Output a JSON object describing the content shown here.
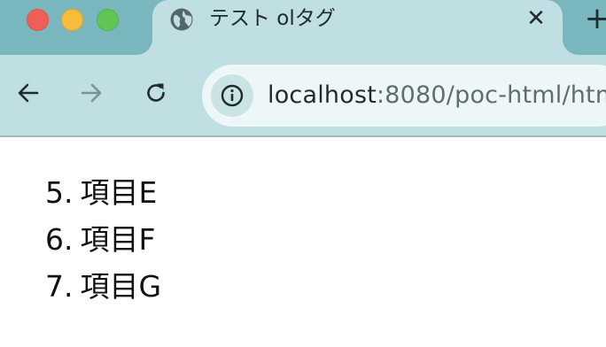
{
  "window": {
    "controls": [
      "close",
      "minimize",
      "maximize"
    ]
  },
  "tab": {
    "title": "テスト olタグ",
    "favicon": "globe-icon",
    "close_glyph": "✕"
  },
  "new_tab_glyph": "+",
  "toolbar": {
    "back_icon": "back-arrow-icon",
    "forward_icon": "forward-arrow-icon",
    "reload_icon": "reload-icon",
    "site_info_icon": "info-icon",
    "url_host": "localhost",
    "url_path": ":8080/poc-html/htm"
  },
  "page": {
    "ordered_list": [
      {
        "number": "5.",
        "text": "項目E"
      },
      {
        "number": "6.",
        "text": "項目F"
      },
      {
        "number": "7.",
        "text": "項目G"
      }
    ]
  },
  "colors": {
    "tabstrip": "#7ab6be",
    "toolbar": "#bfdfe3",
    "omnibox": "#eef7f8"
  }
}
